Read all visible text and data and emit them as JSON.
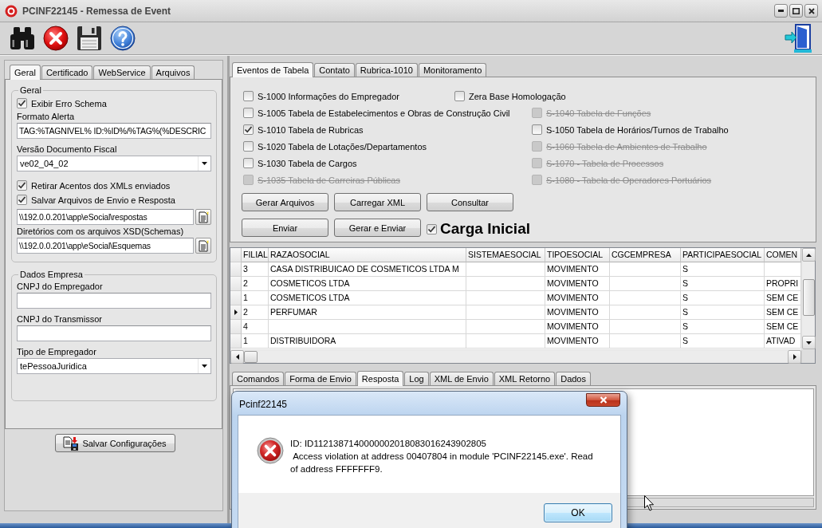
{
  "window": {
    "title": "PCINF22145 - Remessa de Event"
  },
  "config": {
    "tabs": [
      {
        "label": "Geral",
        "selected": true
      },
      {
        "label": "Certificado",
        "selected": false
      },
      {
        "label": "WebService",
        "selected": false
      },
      {
        "label": "Arquivos",
        "selected": false
      }
    ],
    "groups": [
      {
        "title": "Geral",
        "items": [
          {
            "kind": "checkbox",
            "label": "Exibir Erro Schema",
            "checked": true
          },
          {
            "kind": "label",
            "text": "Formato Alerta"
          },
          {
            "kind": "input",
            "value": "TAG:%TAGNIVEL% ID:%ID%/%TAG%(%DESCRIC"
          },
          {
            "kind": "label",
            "text": "Versão Documento Fiscal"
          },
          {
            "kind": "select",
            "value": "ve02_04_02"
          },
          {
            "kind": "checkbox",
            "label": "Retirar Acentos dos XMLs enviados",
            "checked": true
          },
          {
            "kind": "checkbox",
            "label": "Salvar Arquivos de Envio e Resposta",
            "checked": true
          },
          {
            "kind": "path",
            "value": "\\\\192.0.0.201\\app\\eSocial\\respostas"
          },
          {
            "kind": "label",
            "text": "Diretórios com os arquivos XSD(Schemas)"
          },
          {
            "kind": "path",
            "value": "\\\\192.0.0.201\\app\\eSocial\\Esquemas"
          }
        ]
      },
      {
        "title": "Dados Empresa",
        "items": [
          {
            "kind": "label",
            "text": "CNPJ do Empregador"
          },
          {
            "kind": "input"
          },
          {
            "kind": "label",
            "text": "CNPJ do Transmissor"
          },
          {
            "kind": "input"
          },
          {
            "kind": "label",
            "text": "Tipo de Empregador"
          },
          {
            "kind": "select",
            "value": "tePessoaJuridica"
          }
        ]
      }
    ],
    "save_button": "Salvar Configurações"
  },
  "events": {
    "tabs": [
      {
        "label": "Eventos de Tabela",
        "selected": true
      },
      {
        "label": "Contato",
        "selected": false
      },
      {
        "label": "Rubrica-1010",
        "selected": false
      },
      {
        "label": "Monitoramento",
        "selected": false
      }
    ],
    "left_options": [
      {
        "label": "S-1000 Informações do Empregador",
        "checked": false,
        "disabled": false
      },
      {
        "label": "S-1005 Tabela de Estabelecimentos e Obras de Construção Civil",
        "checked": false,
        "disabled": false
      },
      {
        "label": "S-1010 Tabela de Rubricas",
        "checked": true,
        "disabled": false
      },
      {
        "label": "S-1020 Tabela de Lotações/Departamentos",
        "checked": false,
        "disabled": false
      },
      {
        "label": "S-1030 Tabela de Cargos",
        "checked": false,
        "disabled": false
      },
      {
        "label": "S-1035 Tabela de Carreiras Públicas",
        "checked": false,
        "disabled": true
      }
    ],
    "zera_base": {
      "label": "Zera Base Homologação",
      "checked": false
    },
    "right_options": [
      {
        "label": "S-1040 Tabela de Funções",
        "checked": false,
        "disabled": true
      },
      {
        "label": "S-1050 Tabela de Horários/Turnos de Trabalho",
        "checked": false,
        "disabled": false
      },
      {
        "label": "S-1060 Tabela de Ambientes de Trabalho",
        "checked": false,
        "disabled": true
      },
      {
        "label": "S-1070 - Tabela de Processos",
        "checked": false,
        "disabled": true
      },
      {
        "label": "S-1080 - Tabela de Operadores Portuários",
        "checked": false,
        "disabled": true
      }
    ],
    "button_rows": [
      [
        "Gerar Arquivos",
        "Carregar XML",
        "Consultar"
      ],
      [
        "Enviar",
        "Gerar e Enviar"
      ]
    ],
    "carga_inicial": {
      "label": "Carga Inicial",
      "checked": true
    }
  },
  "grid": {
    "columns": [
      "FILIAL",
      "RAZAOSOCIAL",
      "SISTEMAESOCIAL",
      "TIPOESOCIAL",
      "CGCEMPRESA",
      "PARTICIPAESOCIAL",
      "COMEN"
    ],
    "rows": [
      {
        "selected": false,
        "cells": [
          "3",
          "CASA DISTRIBUICAO DE COSMETICOS LTDA M",
          null,
          "MOVIMENTO",
          null,
          "S",
          null
        ]
      },
      {
        "selected": false,
        "cells": [
          "2",
          "COSMETICOS LTDA",
          null,
          "MOVIMENTO",
          null,
          "S",
          "PROPRI"
        ]
      },
      {
        "selected": false,
        "cells": [
          "1",
          "COSMETICOS LTDA",
          null,
          "MOVIMENTO",
          null,
          "S",
          "SEM CE"
        ]
      },
      {
        "selected": true,
        "cells": [
          "2",
          "PERFUMAR",
          null,
          "MOVIMENTO",
          null,
          "S",
          "SEM CE"
        ]
      },
      {
        "selected": false,
        "cells": [
          "4",
          null,
          null,
          "MOVIMENTO",
          null,
          "S",
          "SEM CE"
        ]
      },
      {
        "selected": false,
        "cells": [
          "1",
          "DISTRIBUIDORA",
          null,
          "MOVIMENTO",
          null,
          "S",
          "ATIVAD"
        ]
      }
    ]
  },
  "output_tabs": [
    {
      "label": "Comandos",
      "selected": false
    },
    {
      "label": "Forma de Envio",
      "selected": false
    },
    {
      "label": "Resposta",
      "selected": true
    },
    {
      "label": "Log",
      "selected": false
    },
    {
      "label": "XML de Envio",
      "selected": false
    },
    {
      "label": "XML Retorno",
      "selected": false
    },
    {
      "label": "Dados",
      "selected": false
    }
  ],
  "dialog": {
    "title": "Pcinf22145",
    "message": "ID: ID1121387140000002018083016243902805\n Access violation at address 00407804 in module 'PCINF22145.exe'. Read of address FFFFFFF9.",
    "button": "OK"
  }
}
